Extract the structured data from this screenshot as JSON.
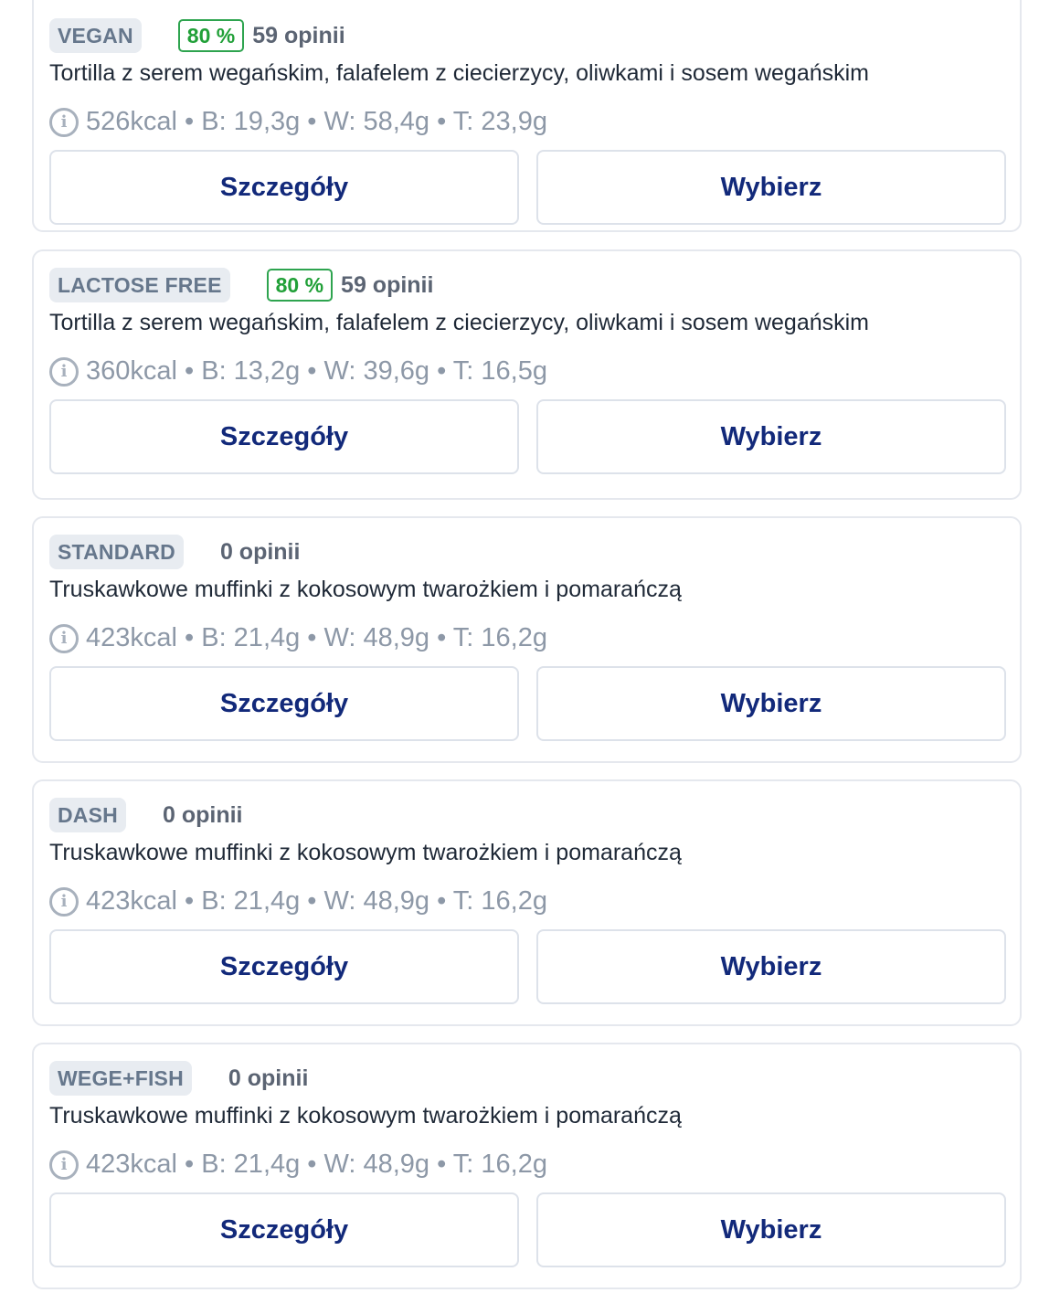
{
  "meals": [
    {
      "tag": "VEGAN",
      "rating": "80 %",
      "reviews": "59 opinii",
      "description": "Tortilla z serem wegańskim, falafelem z ciecierzycy, oliwkami i sosem wegańskim",
      "macros": "526kcal • B: 19,3g • W: 58,4g • T: 23,9g",
      "details_label": "Szczegóły",
      "choose_label": "Wybierz"
    },
    {
      "tag": "LACTOSE FREE",
      "rating": "80 %",
      "reviews": "59 opinii",
      "description": "Tortilla z serem wegańskim, falafelem z ciecierzycy, oliwkami i sosem wegańskim",
      "macros": "360kcal • B: 13,2g • W: 39,6g • T: 16,5g",
      "details_label": "Szczegóły",
      "choose_label": "Wybierz"
    },
    {
      "tag": "STANDARD",
      "rating": "",
      "reviews": "0 opinii",
      "description": "Truskawkowe muffinki z kokosowym twarożkiem i pomarańczą",
      "macros": "423kcal • B: 21,4g • W: 48,9g • T: 16,2g",
      "details_label": "Szczegóły",
      "choose_label": "Wybierz"
    },
    {
      "tag": "DASH",
      "rating": "",
      "reviews": "0 opinii",
      "description": "Truskawkowe muffinki z kokosowym twarożkiem i pomarańczą",
      "macros": "423kcal • B: 21,4g • W: 48,9g • T: 16,2g",
      "details_label": "Szczegóły",
      "choose_label": "Wybierz"
    },
    {
      "tag": "WEGE+FISH",
      "rating": "",
      "reviews": "0 opinii",
      "description": "Truskawkowe muffinki z kokosowym twarożkiem i pomarańczą",
      "macros": "423kcal • B: 21,4g • W: 48,9g • T: 16,2g",
      "details_label": "Szczegóły",
      "choose_label": "Wybierz"
    }
  ],
  "icons": {
    "info": "info-icon"
  },
  "colors": {
    "rating_green": "#21a038",
    "button_text": "#12297a",
    "tag_bg": "#e8ecf1"
  }
}
